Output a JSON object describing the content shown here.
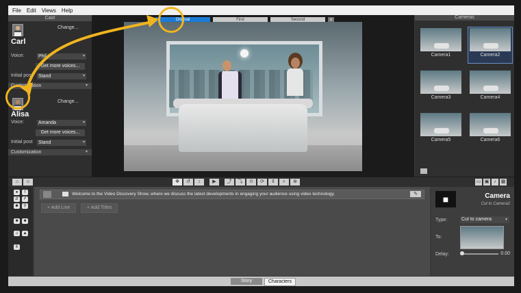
{
  "menu": [
    "File",
    "Edit",
    "Views",
    "Help"
  ],
  "cast": {
    "title": "Cast",
    "characters": [
      {
        "name": "Carl",
        "change": "Change...",
        "voice_label": "Voice:",
        "voice": "Phil",
        "more_voices": "Get more voices...",
        "pose_label": "Initial post",
        "pose": "Stand",
        "customization": "Customization"
      },
      {
        "name": "Alisa",
        "change": "Change...",
        "voice_label": "Voice:",
        "voice": "Amanda",
        "more_voices": "Get more voices...",
        "pose_label": "Initial post",
        "pose": "Stand",
        "customization": "Customization"
      }
    ]
  },
  "preview": {
    "tabs": [
      "Original",
      "First",
      "Second"
    ],
    "close": "×"
  },
  "cameras": {
    "title": "Cameras",
    "items": [
      "Camera1",
      "Camera2",
      "Camera3",
      "Camera4",
      "Camera5",
      "Camera6"
    ],
    "selected": "Camera2"
  },
  "story": {
    "line_text": "Welcome to the Video Discovery Show, where we discuss the latest developments in engaging your audience using video technology.",
    "add_line": "+ Add Line",
    "add_titles": "+ Add Titles"
  },
  "camera_props": {
    "title": "Camera",
    "subtitle": "Cut to Camera2",
    "type_label": "Type:",
    "type_value": "Cut to camera",
    "to_label": "To:",
    "delay_label": "Delay:",
    "delay_value": "0.00"
  },
  "bottom_tabs": [
    "Story",
    "Characters"
  ],
  "colors": {
    "accent": "#1a7bd6",
    "annotation": "#f0b41f",
    "panel": "#2e2e2e"
  }
}
